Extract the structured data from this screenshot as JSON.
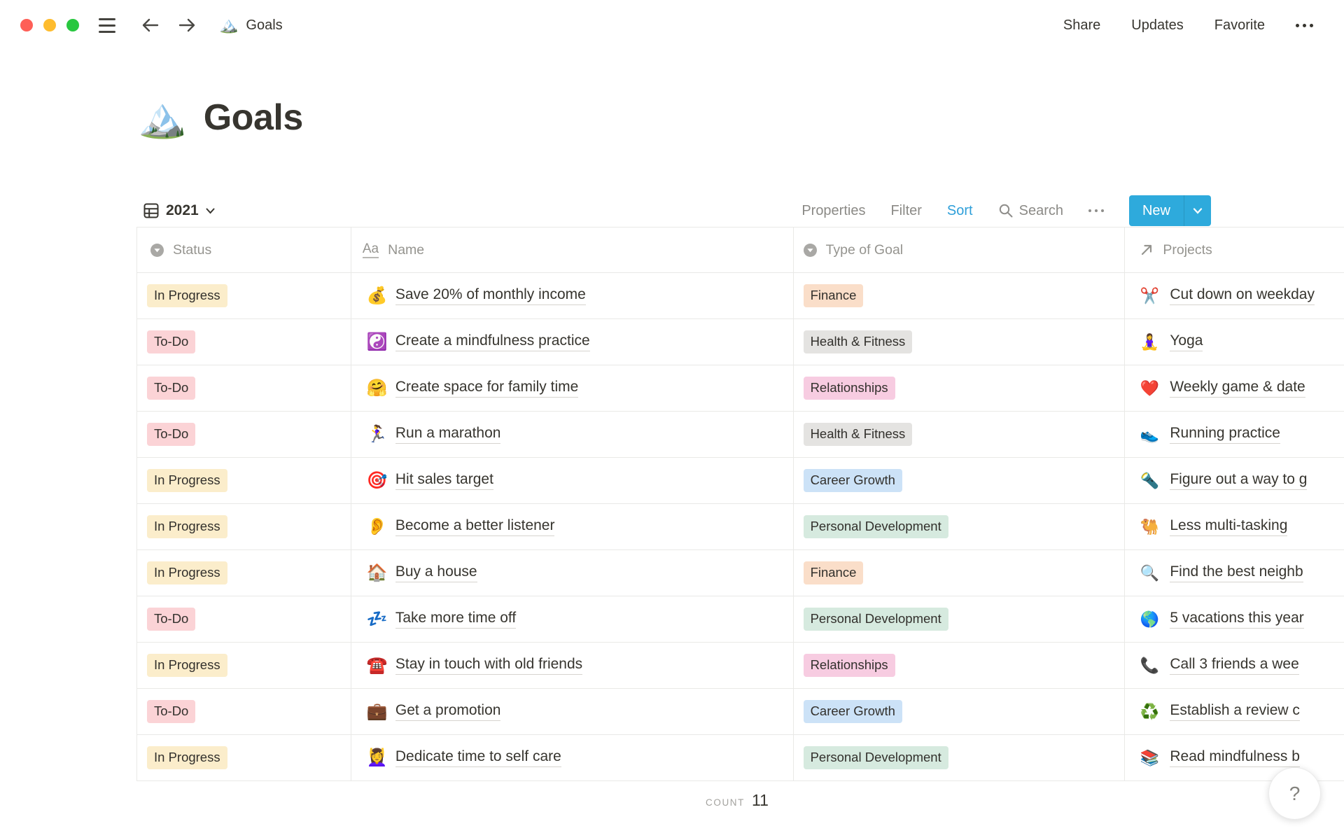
{
  "window": {
    "doc_icon": "🏔️",
    "doc_title": "Goals",
    "menu": {
      "share": "Share",
      "updates": "Updates",
      "favorite": "Favorite"
    }
  },
  "page": {
    "icon": "🏔️",
    "title": "Goals"
  },
  "toolbar": {
    "view_name": "2021",
    "properties": "Properties",
    "filter": "Filter",
    "sort": "Sort",
    "search": "Search",
    "new_label": "New"
  },
  "colors": {
    "accent_blue": "#2EAADC",
    "sort_active": "#2E9FD9",
    "traffic_red": "#FE5F57",
    "traffic_yellow": "#FEBC2E",
    "traffic_green": "#28C73F"
  },
  "table": {
    "columns": [
      {
        "label": "Status"
      },
      {
        "label": "Name"
      },
      {
        "label": "Type of Goal"
      },
      {
        "label": "Projects"
      }
    ],
    "badge_colors": {
      "In Progress": "#FBEDCB",
      "To-Do": "#FBD3D6",
      "Finance": "#FADEC9",
      "Health & Fitness": "#E4E3E1",
      "Relationships": "#F7CCE1",
      "Career Growth": "#CCE2F7",
      "Personal Development": "#D6EADF"
    },
    "rows": [
      {
        "status": "In Progress",
        "name_icon": "💰",
        "name": "Save 20% of monthly income",
        "type": "Finance",
        "project_icon": "✂️",
        "project": "Cut down on weekday"
      },
      {
        "status": "To-Do",
        "name_icon": "☯️",
        "name": "Create a mindfulness practice",
        "type": "Health & Fitness",
        "project_icon": "🧘‍♀️",
        "project": "Yoga"
      },
      {
        "status": "To-Do",
        "name_icon": "🤗",
        "name": "Create space for family time",
        "type": "Relationships",
        "project_icon": "❤️",
        "project": "Weekly game & date"
      },
      {
        "status": "To-Do",
        "name_icon": "🏃‍♀️",
        "name": "Run a marathon",
        "type": "Health & Fitness",
        "project_icon": "👟",
        "project": "Running practice"
      },
      {
        "status": "In Progress",
        "name_icon": "🎯",
        "name": "Hit sales target",
        "type": "Career Growth",
        "project_icon": "🔦",
        "project": "Figure out a way to g"
      },
      {
        "status": "In Progress",
        "name_icon": "👂",
        "name": "Become a better listener",
        "type": "Personal Development",
        "project_icon": "🐫",
        "project": "Less multi-tasking"
      },
      {
        "status": "In Progress",
        "name_icon": "🏠",
        "name": "Buy a house",
        "type": "Finance",
        "project_icon": "🔍",
        "project": "Find the best neighb"
      },
      {
        "status": "To-Do",
        "name_icon": "💤",
        "name": "Take more time off",
        "type": "Personal Development",
        "project_icon": "🌎",
        "project": "5 vacations this year"
      },
      {
        "status": "In Progress",
        "name_icon": "☎️",
        "name": "Stay in touch with old friends",
        "type": "Relationships",
        "project_icon": "📞",
        "project": "Call 3 friends a wee"
      },
      {
        "status": "To-Do",
        "name_icon": "💼",
        "name": "Get a promotion",
        "type": "Career Growth",
        "project_icon": "♻️",
        "project": "Establish a review c"
      },
      {
        "status": "In Progress",
        "name_icon": "💆‍♀️",
        "name": "Dedicate time to self care",
        "type": "Personal Development",
        "project_icon": "📚",
        "project": "Read mindfulness b"
      }
    ]
  },
  "footer": {
    "count_label": "COUNT",
    "count_value": "11"
  },
  "help": {
    "label": "?"
  }
}
